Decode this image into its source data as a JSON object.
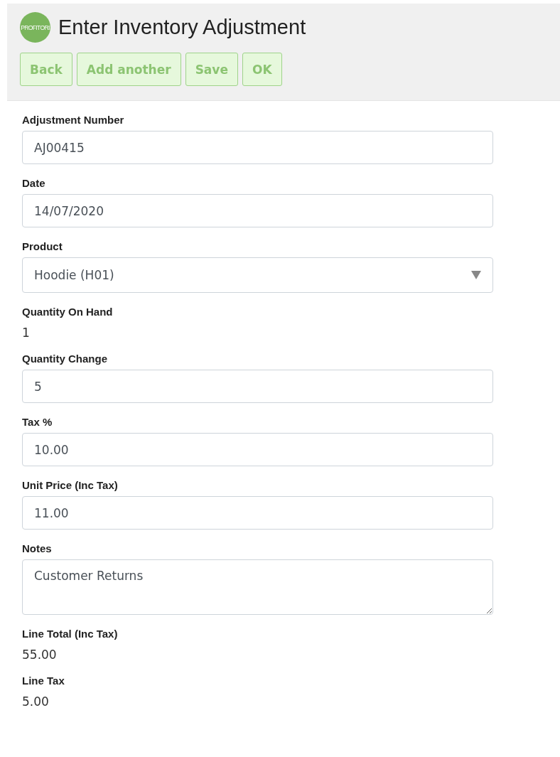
{
  "header": {
    "logo_text": "PROFITORI",
    "title": "Enter Inventory Adjustment"
  },
  "buttons": [
    "Back",
    "Add another",
    "Save",
    "OK"
  ],
  "fields": [
    {
      "kind": "input",
      "label": "Adjustment Number",
      "value": "AJ00415"
    },
    {
      "kind": "input",
      "label": "Date",
      "value": "14/07/2020"
    },
    {
      "kind": "select",
      "label": "Product",
      "value": "Hoodie (H01)"
    },
    {
      "kind": "readonly",
      "label": "Quantity On Hand",
      "value": "1"
    },
    {
      "kind": "input",
      "label": "Quantity Change",
      "value": "5"
    },
    {
      "kind": "input",
      "label": "Tax %",
      "value": "10.00"
    },
    {
      "kind": "input",
      "label": "Unit Price (Inc Tax)",
      "value": "11.00"
    },
    {
      "kind": "textarea",
      "label": "Notes",
      "value": "Customer Returns"
    },
    {
      "kind": "readonly",
      "label": "Line Total (Inc Tax)",
      "value": "55.00"
    },
    {
      "kind": "readonly",
      "label": "Line Tax",
      "value": "5.00"
    }
  ]
}
